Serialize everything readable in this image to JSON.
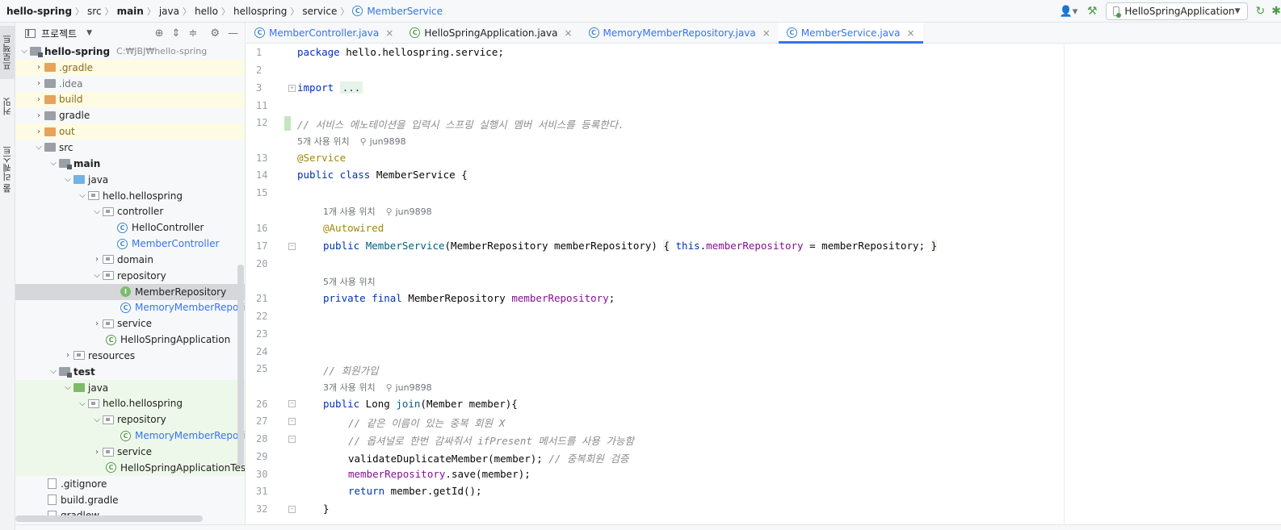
{
  "breadcrumb": {
    "items": [
      "hello-spring",
      "src",
      "main",
      "java",
      "hello",
      "hellospring",
      "service"
    ],
    "current": "MemberService"
  },
  "toolbar": {
    "run_config": "HelloSpringApplication"
  },
  "left_strip": {
    "tabs": [
      "프로젝트",
      "커밋",
      "풀 리퀘스트"
    ]
  },
  "project": {
    "title": "프로젝트",
    "root_name": "hello-spring",
    "root_path": "C:₩JBJ₩hello-spring",
    "items": [
      {
        "label": ".gradle"
      },
      {
        "label": ".idea"
      },
      {
        "label": "build"
      },
      {
        "label": "gradle"
      },
      {
        "label": "out"
      },
      {
        "label": "src"
      },
      {
        "label": "main"
      },
      {
        "label": "java"
      },
      {
        "label": "hello.hellospring"
      },
      {
        "label": "controller"
      },
      {
        "label": "HelloController"
      },
      {
        "label": "MemberController"
      },
      {
        "label": "domain"
      },
      {
        "label": "repository"
      },
      {
        "label": "MemberRepository"
      },
      {
        "label": "MemoryMemberReposito"
      },
      {
        "label": "service"
      },
      {
        "label": "HelloSpringApplication"
      },
      {
        "label": "resources"
      },
      {
        "label": "test"
      },
      {
        "label": "java"
      },
      {
        "label": "hello.hellospring"
      },
      {
        "label": "repository"
      },
      {
        "label": "MemoryMemberReposito"
      },
      {
        "label": "service"
      },
      {
        "label": "HelloSpringApplicationTests"
      },
      {
        "label": ".gitignore"
      },
      {
        "label": "build.gradle"
      },
      {
        "label": "gradlew"
      }
    ]
  },
  "tabs": [
    {
      "label": "MemberController.java"
    },
    {
      "label": "HelloSpringApplication.java"
    },
    {
      "label": "MemoryMemberRepository.java"
    },
    {
      "label": "MemberService.java"
    }
  ],
  "editor": {
    "line_numbers": [
      "1",
      "2",
      "3",
      "11",
      "12",
      "13",
      "14",
      "15",
      "16",
      "17",
      "20",
      "21",
      "22",
      "23",
      "24",
      "25",
      "26",
      "27",
      "28",
      "29",
      "30",
      "31",
      "32"
    ],
    "hints": {
      "usage5": "5개 사용 위치",
      "usage1": "1개 사용 위치",
      "usage5b": "5개 사용 위치",
      "usage3": "3개 사용 위치",
      "author": "jun9898"
    },
    "code": {
      "l1_kw": "package",
      "l1_rest": " hello.hellospring.service;",
      "l3_kw": "import",
      "l3_fold": "...",
      "l12_comment": "// 서비스 에노테이션을 입력시 스프링 실행시 멤버 서비스를 등록한다.",
      "l13_ann": "@Service",
      "l14_kw": "public class",
      "l14_rest": " MemberService {",
      "l16_ann": "@Autowired",
      "l17_kw": "public",
      "l17_fn": "MemberService",
      "l17_params": "(MemberRepository memberRepository) ",
      "l17_open": "{",
      "l17_this": "this",
      "l17_dot": ".",
      "l17_fld": "memberRepository",
      "l17_assign": " = memberRepository; ",
      "l17_close": "}",
      "l21_kw": "private final",
      "l21_type": " MemberRepository ",
      "l21_fld": "memberRepository",
      "l21_semi": ";",
      "l25_comment": "// 회원가입",
      "l26_kw": "public",
      "l26_type": " Long ",
      "l26_fn": "join",
      "l26_rest": "(Member member){",
      "l27_comment": "// 같은 이름이 있는 중복 회원 X",
      "l28_comment": "// 옵셔널로 한번 감싸줘서 ifPresent 메서드를 사용 가능함",
      "l29_code": "validateDuplicateMember(member); ",
      "l29_comment": "// 중복회원 검증",
      "l30_fld": "memberRepository",
      "l30_rest": ".save(member);",
      "l31_kw": "return",
      "l31_rest": " member.getId();",
      "l32_close": "}"
    }
  }
}
